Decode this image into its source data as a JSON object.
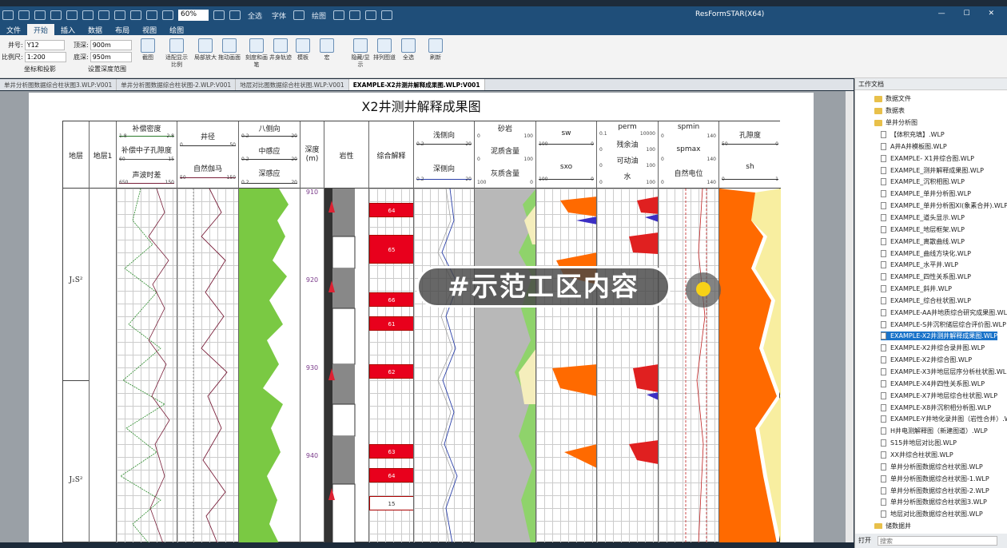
{
  "app": {
    "title": "ResFormSTAR(X64)",
    "zoom": "60%",
    "qat_labels": [
      "全选",
      "字体",
      "绘图"
    ]
  },
  "menu": [
    "文件",
    "开始",
    "插入",
    "数据",
    "布局",
    "视图",
    "绘图"
  ],
  "ribbon": {
    "well_label": "井号:",
    "well_value": "Y12",
    "top_label": "顶深:",
    "top_value": "900m",
    "scale_label": "比例尺:",
    "scale_value": "1:200",
    "bottom_label": "底深:",
    "bottom_value": "950m",
    "coord_label": "坐标和投影",
    "depth_range_label": "设置深度范围",
    "buttons": [
      "截图",
      "适配显示比例",
      "局部放大",
      "拖动画面",
      "刻度和画笔",
      "井身轨迹",
      "模板",
      "宏",
      "隐藏/显示",
      "排列图道",
      "全选",
      "刷新"
    ]
  },
  "tabs": [
    "单井分析图数据综合柱状图3.WLP:V001",
    "单井分析图数据综合柱状图-2.WLP:V001",
    "地层对比图数据综合柱状图.WLP:V001",
    "EXAMPLE-X2井测井解释成果图.WLP:V001"
  ],
  "sheet": {
    "title": "X2井测井解释成果图",
    "tracks": {
      "strata": "地层",
      "strata1": "地层1",
      "porosity": {
        "l1": "补偿密度",
        "s1": [
          "1.8",
          "2.8"
        ],
        "l2": "补偿中子孔隙度",
        "s2": [
          "60",
          "-15"
        ],
        "l3": "声波时差",
        "s3": [
          "650",
          "150"
        ]
      },
      "caliper": {
        "l1": "井径",
        "s1": [
          "0",
          "50"
        ],
        "l2": "自然伽马",
        "s2": [
          "50",
          "150"
        ]
      },
      "resist": {
        "l1": "八侧向",
        "s1": [
          "0.2",
          "20"
        ],
        "l2": "中感应",
        "s2": [
          "0.2",
          "20"
        ],
        "l3": "深感应",
        "s3": [
          "0.2",
          "20"
        ]
      },
      "depth": "深度",
      "depth_unit": "(m)",
      "litho": "岩性",
      "interp": "综合解释",
      "lat": {
        "l1": "浅侧向",
        "s1": [
          "0.2",
          "20"
        ],
        "l2": "深侧向",
        "s2": [
          "0.2",
          "20"
        ]
      },
      "mineral": {
        "l1": "砂岩",
        "s1": [
          "0",
          "100"
        ],
        "l2": "泥质含量",
        "s2": [
          "0",
          "100"
        ],
        "l3": "灰质含量",
        "s3": [
          "100",
          "0"
        ]
      },
      "sat": {
        "l1": "sw",
        "s1": [
          "100",
          "0"
        ],
        "l2": "sxo",
        "s2": [
          "100",
          "0"
        ]
      },
      "perm": {
        "l1": "perm",
        "s1": [
          "0.1",
          "10000"
        ],
        "l2": "残余油",
        "s2": [
          "0",
          "100"
        ],
        "l3": "可动油",
        "s3": [
          "0",
          "100"
        ],
        "l4": "水",
        "s4": [
          "0",
          "100"
        ]
      },
      "sp": {
        "l1": "spmin",
        "s1": [
          "0",
          "140"
        ],
        "l2": "spmax",
        "s2": [
          "0",
          "140"
        ],
        "l3": "自然电位",
        "s3": [
          "0",
          "140"
        ]
      },
      "por2": {
        "l1": "孔隙度",
        "s1": [
          "50",
          "0"
        ],
        "l2": "sh",
        "s2": [
          "0",
          "1"
        ]
      }
    },
    "strata_labels": [
      "J₁S²",
      "J₂S²"
    ],
    "depth_ticks": [
      "910",
      "920",
      "930",
      "940"
    ],
    "interp_labels": [
      "64",
      "65",
      "66",
      "61",
      "62",
      "63",
      "64",
      "15"
    ]
  },
  "overlay": {
    "text": "#示范工区内容"
  },
  "panel": {
    "title": "工作文档",
    "folders": [
      "数据文件",
      "数据表",
      "单井分析图"
    ],
    "files": [
      "【体积充填】.WLP",
      "A井A井模板图.WLP",
      "EXAMPLE- X1井综合图.WLP",
      "EXAMPLE_测井解释成果图.WLP",
      "EXAMPLE_沉积相图.WLP",
      "EXAMPLE_单井分析图.WLP",
      "EXAMPLE_单井分析图XI(象素合并).WLP",
      "EXAMPLE_道头显示.WLP",
      "EXAMPLE_地层框架.WLP",
      "EXAMPLE_离散曲线.WLP",
      "EXAMPLE_曲线方块化.WLP",
      "EXAMPLE_水平井.WLP",
      "EXAMPLE_四性关系图.WLP",
      "EXAMPLE_斜井.WLP",
      "EXAMPLE_综合柱状图.WLP",
      "EXAMPLE-AA井地质综合研究成果图.WLP",
      "EXAMPLE-S井沉积储层综合评价图.WLP",
      "EXAMPLE-X2井测井解释成果图.WLP",
      "EXAMPLE-X2井综合录井图.WLP",
      "EXAMPLE-X2井综合图.WLP",
      "EXAMPLE-X3井地层层序分析柱状图.WLP",
      "EXAMPLE-X4井四性关系图.WLP",
      "EXAMPLE-X7井地层综合柱状图.WLP",
      "EXAMPLE-X8井沉积相分析图.WLP",
      "EXAMPLE-Y井地化录井图（岩性合并）.WLP",
      "H井电测解释图（新建图道）.WLP",
      "S15井地层对比图.WLP",
      "XX井综合柱状图.WLP",
      "单井分析图数据综合柱状图.WLP",
      "单井分析图数据综合柱状图-1.WLP",
      "单井分析图数据综合柱状图-2.WLP",
      "单井分析图数据综合柱状图3.WLP",
      "地层对比图数据综合柱状图.WLP"
    ],
    "last_folder": "储数据井",
    "footer_label": "打开",
    "search_placeholder": "搜索"
  }
}
